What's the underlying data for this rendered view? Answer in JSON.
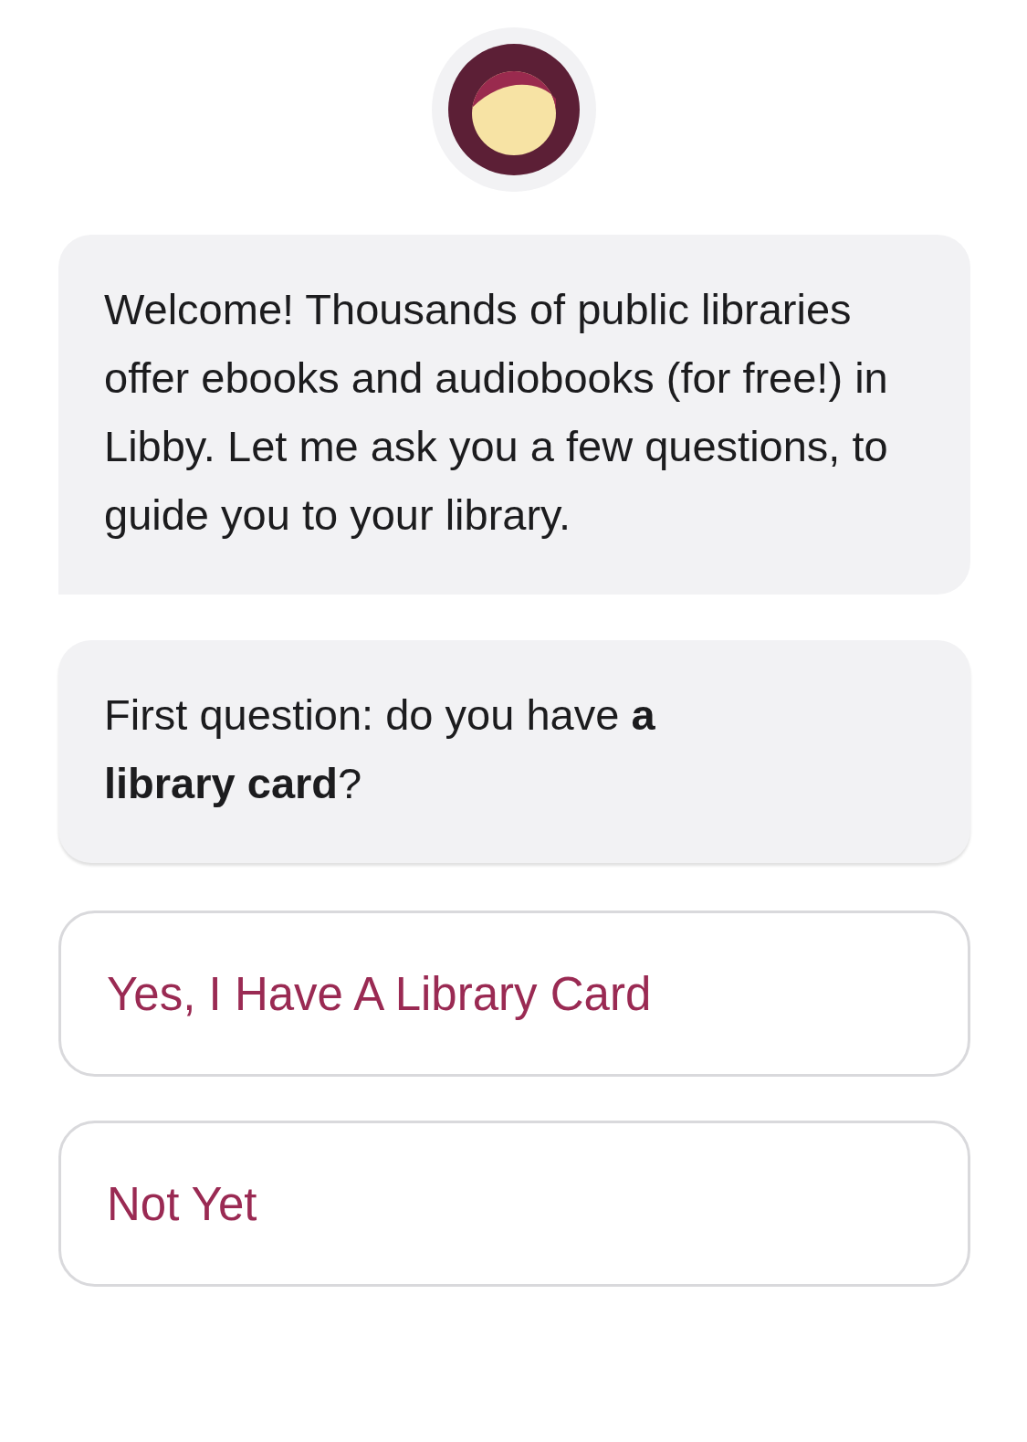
{
  "messages": [
    {
      "text": "Welcome! Thousands of public libraries offer ebooks and audiobooks (for free!) in Libby. Let me ask you a few questions, to guide you to your library."
    },
    {
      "text": "First question: do you have **a library card**?"
    }
  ],
  "options": [
    {
      "label": "Yes, I Have A Library Card"
    },
    {
      "label": "Not Yet"
    }
  ]
}
